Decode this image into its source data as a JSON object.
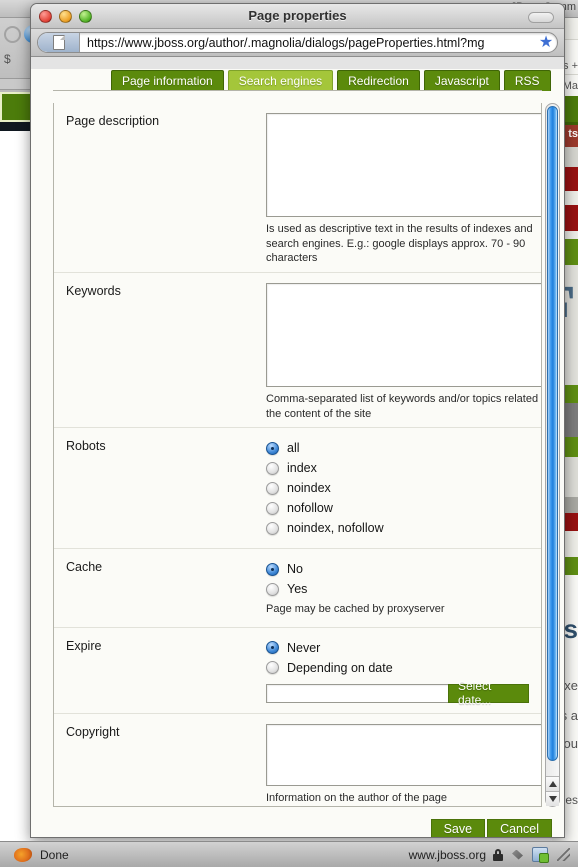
{
  "browser": {
    "window_title": "Page properties",
    "url": "https://www.jboss.org/author/.magnolia/dialogs/pageProperties.html?mg",
    "favicon_name": "document-icon",
    "bookmark_star": "★",
    "traffic_lights": [
      "close",
      "minimize",
      "zoom"
    ]
  },
  "background": {
    "top_bar_text": "JBoss Comm",
    "fragments": [
      "ts +",
      "Ma",
      "ts",
      "F",
      "ns",
      "xe",
      "s a",
      "ou",
      "ces",
      "$"
    ]
  },
  "tabs": [
    {
      "label": "Page information",
      "active": false
    },
    {
      "label": "Search engines",
      "active": true
    },
    {
      "label": "Redirection",
      "active": false
    },
    {
      "label": "Javascript",
      "active": false
    },
    {
      "label": "RSS",
      "active": false
    }
  ],
  "fields": {
    "page_description": {
      "label": "Page description",
      "value": "",
      "hint": "Is used as descriptive text in the results of indexes and search engines. E.g.: google displays approx. 70 - 90 characters"
    },
    "keywords": {
      "label": "Keywords",
      "value": "",
      "hint": "Comma-separated list of keywords and/or topics related to the content of the site"
    },
    "robots": {
      "label": "Robots",
      "selected": "all",
      "options": [
        "all",
        "index",
        "noindex",
        "nofollow",
        "noindex, nofollow"
      ]
    },
    "cache": {
      "label": "Cache",
      "selected": "No",
      "options": [
        "No",
        "Yes"
      ],
      "hint": "Page may be cached by proxyserver"
    },
    "expire": {
      "label": "Expire",
      "selected": "Never",
      "options": [
        "Never",
        "Depending on date"
      ],
      "date_value": "",
      "date_button": "Select date..."
    },
    "copyright": {
      "label": "Copyright",
      "value": "",
      "hint": "Information on the author of the page"
    }
  },
  "footer": {
    "save_label": "Save",
    "cancel_label": "Cancel"
  },
  "statusbar": {
    "status": "Done",
    "host": "www.jboss.org",
    "icons": [
      "firefox-icon",
      "lock-icon",
      "plugin-icon",
      "addon-icon",
      "resize-grip-icon"
    ]
  },
  "colors": {
    "tab_inactive": "#5b8a0c",
    "tab_active": "#a4c63a",
    "button_green": "#5b8a0c",
    "radio_selected": "#3e87d6"
  }
}
